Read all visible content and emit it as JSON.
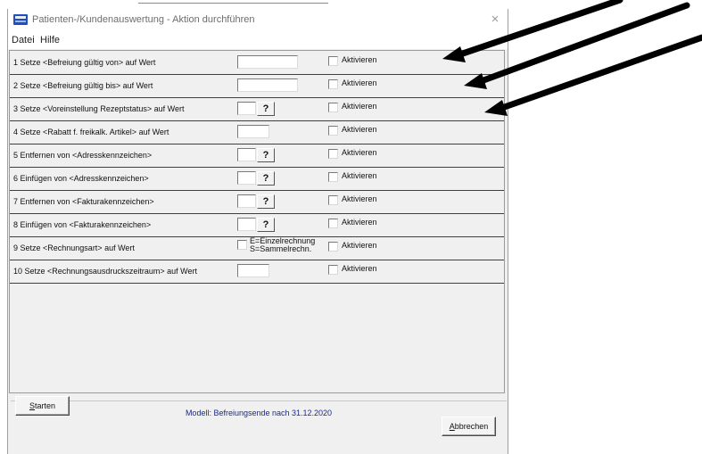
{
  "window": {
    "title": "Patienten-/Kundenauswertung - Aktion durchführen",
    "close_glyph": "×"
  },
  "menu": [
    "Datei",
    "Hilfe"
  ],
  "rows": [
    {
      "label": "1 Setze  <Befreiung gültig von>  auf Wert",
      "checkbox_label": "Aktivieren"
    },
    {
      "label": "2 Setze  <Befreiung gültig bis>  auf Wert",
      "checkbox_label": "Aktivieren"
    },
    {
      "label": "3 Setze  <Voreinstellung Rezeptstatus>  auf Wert",
      "checkbox_label": "Aktivieren",
      "button": "?"
    },
    {
      "label": "4 Setze  <Rabatt f. freikalk. Artikel>  auf Wert",
      "checkbox_label": "Aktivieren"
    },
    {
      "label": "5 Entfernen von  <Adresskennzeichen>",
      "checkbox_label": "Aktivieren",
      "button": "?"
    },
    {
      "label": "6 Einfügen von  <Adresskennzeichen>",
      "checkbox_label": "Aktivieren",
      "button": "?"
    },
    {
      "label": "7 Entfernen von  <Fakturakennzeichen>",
      "checkbox_label": "Aktivieren",
      "button": "?"
    },
    {
      "label": "8 Einfügen von  <Fakturakennzeichen>",
      "checkbox_label": "Aktivieren",
      "button": "?"
    },
    {
      "label": "9 Setze  <Rechnungsart>  auf Wert",
      "checkbox_label": "Aktivieren",
      "option_1": "E=Einzelrechnung",
      "option_2": "S=Sammelrechn."
    },
    {
      "label": "10 Setze  <Rechnungsausdruckszeitraum>  auf Wert",
      "checkbox_label": "Aktivieren"
    }
  ],
  "model_text": "Modell: Befreiungsende nach 31.12.2020",
  "buttons": {
    "start_mnemonic": "S",
    "start_rest": "tarten",
    "cancel_mnemonic": "A",
    "cancel_rest": "bbrechen"
  },
  "colors": {
    "model_text": "#1b2a8a",
    "arrow": "#000000"
  }
}
